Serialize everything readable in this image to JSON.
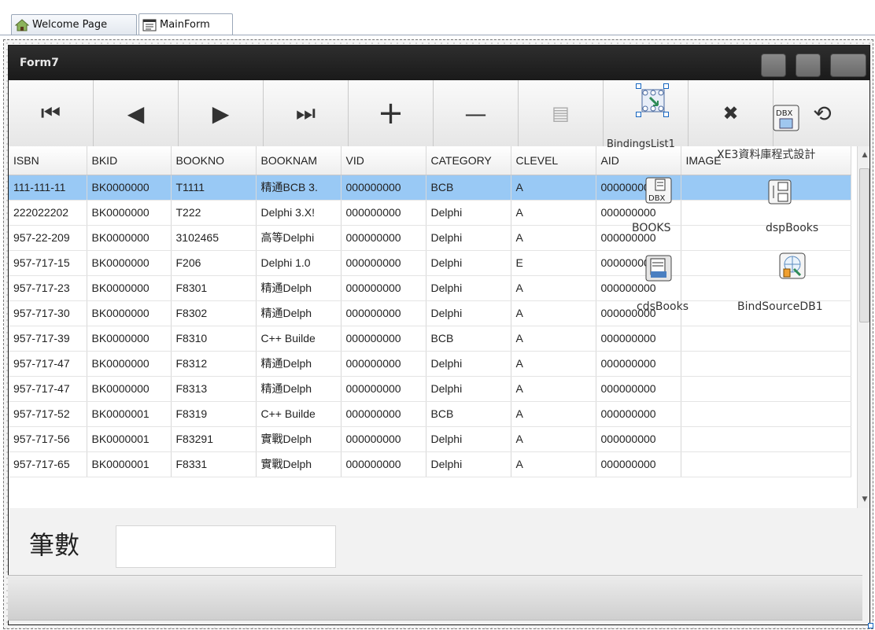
{
  "tabs": [
    {
      "label": "Welcome Page",
      "icon": "home-icon"
    },
    {
      "label": "MainForm",
      "icon": "form-icon"
    }
  ],
  "form": {
    "title": "Form7"
  },
  "navigator": {
    "buttons": [
      {
        "name": "first",
        "glyph": "⏮"
      },
      {
        "name": "prior",
        "glyph": "◀"
      },
      {
        "name": "next",
        "glyph": "▶"
      },
      {
        "name": "last",
        "glyph": "⏭"
      },
      {
        "name": "insert",
        "glyph": "+"
      },
      {
        "name": "delete",
        "glyph": "—"
      },
      {
        "name": "edit",
        "glyph": "▤"
      },
      {
        "name": "post",
        "glyph": ""
      },
      {
        "name": "cancel",
        "glyph": "✖"
      },
      {
        "name": "refresh",
        "glyph": "⟲"
      }
    ]
  },
  "grid": {
    "columns": [
      "ISBN",
      "BKID",
      "BOOKNO",
      "BOOKNAM",
      "VID",
      "CATEGORY",
      "CLEVEL",
      "AID",
      "IMAGE"
    ],
    "rows": [
      [
        "111-111-11",
        "BK0000000",
        "T1111",
        "精通BCB 3.",
        "000000000",
        "BCB",
        "A",
        "000000000",
        ""
      ],
      [
        "222022202",
        "BK0000000",
        "T222",
        "Delphi 3.X!",
        "000000000",
        "Delphi",
        "A",
        "000000000",
        ""
      ],
      [
        "957-22-209",
        "BK0000000",
        "3102465",
        "高等Delphi",
        "000000000",
        "Delphi",
        "A",
        "000000000",
        ""
      ],
      [
        "957-717-15",
        "BK0000000",
        "F206",
        "Delphi 1.0",
        "000000000",
        "Delphi",
        "E",
        "000000000",
        ""
      ],
      [
        "957-717-23",
        "BK0000000",
        "F8301",
        "精通Delph",
        "000000000",
        "Delphi",
        "A",
        "000000000",
        ""
      ],
      [
        "957-717-30",
        "BK0000000",
        "F8302",
        "精通Delph",
        "000000000",
        "Delphi",
        "A",
        "000000000",
        ""
      ],
      [
        "957-717-39",
        "BK0000000",
        "F8310",
        "C++ Builde",
        "000000000",
        "BCB",
        "A",
        "000000000",
        ""
      ],
      [
        "957-717-47",
        "BK0000000",
        "F8312",
        "精通Delph",
        "000000000",
        "Delphi",
        "A",
        "000000000",
        ""
      ],
      [
        "957-717-47",
        "BK0000000",
        "F8313",
        "精通Delph",
        "000000000",
        "Delphi",
        "A",
        "000000000",
        ""
      ],
      [
        "957-717-52",
        "BK0000001",
        "F8319",
        "C++ Builde",
        "000000000",
        "BCB",
        "A",
        "000000000",
        ""
      ],
      [
        "957-717-56",
        "BK0000001",
        "F83291",
        "實戰Delph",
        "000000000",
        "Delphi",
        "A",
        "000000000",
        ""
      ],
      [
        "957-717-65",
        "BK0000001",
        "F8331",
        "實戰Delph",
        "000000000",
        "Delphi",
        "A",
        "000000000",
        ""
      ]
    ],
    "selected_row": 0
  },
  "components": {
    "bindings_list": "BindingsList1",
    "connection": "XE3資料庫程式設計",
    "dataset": "BOOKS",
    "provider": "dspBooks",
    "client_dataset": "cdsBooks",
    "bind_source": "BindSourceDB1"
  },
  "count": {
    "label": "筆數",
    "value": ""
  },
  "colors": {
    "selection": "#99c9f5",
    "titlebar": "#1f1f1f"
  }
}
